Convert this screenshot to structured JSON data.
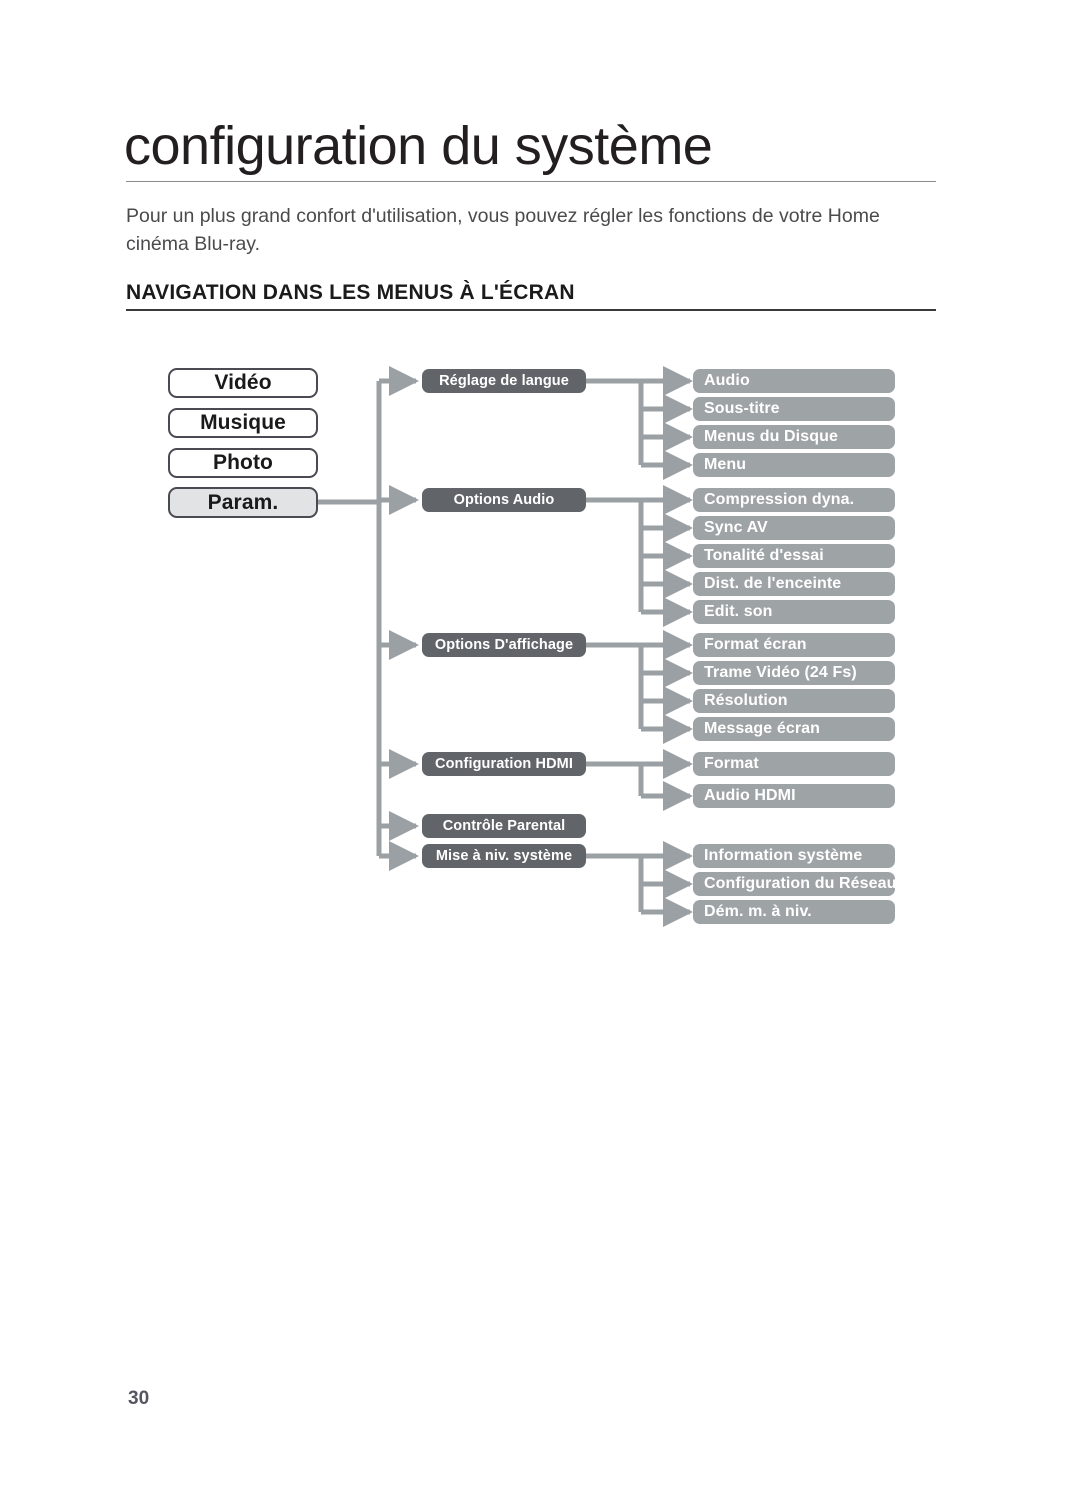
{
  "page": {
    "title": "configuration du système",
    "intro": "Pour un plus grand confort d'utilisation, vous pouvez régler les fonctions de votre Home cinéma Blu-ray.",
    "section_heading": "NAVIGATION DANS LES MENUS À L'ÉCRAN",
    "page_number": "30"
  },
  "colors": {
    "level1_fill": "#ffffff",
    "level1_selected_fill": "#e2e3e5",
    "level1_border": "#4a4a52",
    "level2_fill": "#616468",
    "level3_fill": "#9ea3a5",
    "connector": "#9aa0a3",
    "text_dark": "#1a1a1a",
    "text_light": "#ffffff",
    "rule": "#8b8b8e",
    "page_number": "#55555f"
  },
  "diagram": {
    "level1": [
      {
        "label": "Vidéo",
        "selected": false
      },
      {
        "label": "Musique",
        "selected": false
      },
      {
        "label": "Photo",
        "selected": false
      },
      {
        "label": "Param.",
        "selected": true
      }
    ],
    "level2": [
      {
        "label": "Réglage de langue"
      },
      {
        "label": "Options Audio"
      },
      {
        "label": "Options D'affichage"
      },
      {
        "label": "Configuration HDMI"
      },
      {
        "label": "Contrôle Parental"
      },
      {
        "label": "Mise à niv. système"
      }
    ],
    "level3": [
      {
        "label": "Audio"
      },
      {
        "label": "Sous-titre"
      },
      {
        "label": "Menus du Disque"
      },
      {
        "label": "Menu"
      },
      {
        "label": "Compression dyna."
      },
      {
        "label": "Sync AV"
      },
      {
        "label": "Tonalité d'essai"
      },
      {
        "label": "Dist. de l'enceinte"
      },
      {
        "label": "Edit. son"
      },
      {
        "label": "Format écran"
      },
      {
        "label": "Trame Vidéo (24 Fs)"
      },
      {
        "label": "Résolution"
      },
      {
        "label": "Message écran"
      },
      {
        "label": "Format"
      },
      {
        "label": "Audio HDMI"
      },
      {
        "label": "Information système"
      },
      {
        "label": "Configuration du Réseau"
      },
      {
        "label": "Dém. m. à niv."
      }
    ],
    "groups": [
      {
        "parent": "Réglage de langue",
        "children": [
          "Audio",
          "Sous-titre",
          "Menus du Disque",
          "Menu"
        ]
      },
      {
        "parent": "Options Audio",
        "children": [
          "Compression dyna.",
          "Sync AV",
          "Tonalité d'essai",
          "Dist. de l'enceinte",
          "Edit. son"
        ]
      },
      {
        "parent": "Options D'affichage",
        "children": [
          "Format écran",
          "Trame Vidéo (24 Fs)",
          "Résolution",
          "Message écran"
        ]
      },
      {
        "parent": "Configuration HDMI",
        "children": [
          "Format",
          "Audio HDMI"
        ]
      },
      {
        "parent": "Contrôle Parental",
        "children": []
      },
      {
        "parent": "Mise à niv. système",
        "children": [
          "Information système",
          "Configuration du Réseau",
          "Dém. m. à niv."
        ]
      }
    ]
  }
}
